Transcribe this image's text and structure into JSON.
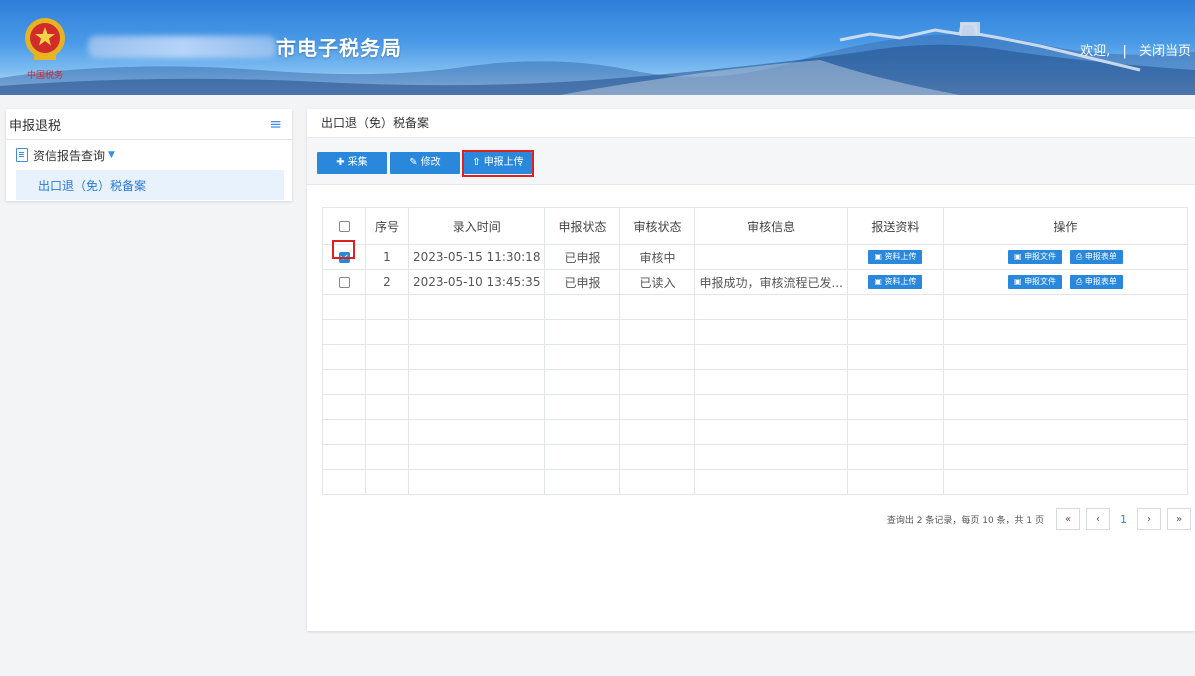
{
  "header": {
    "title": "市电子税务局",
    "welcome": "欢迎,",
    "separator": "|",
    "close_page": "关闭当页"
  },
  "sidebar": {
    "title": "申报退税",
    "group_label": "资信报告查询",
    "items": [
      {
        "label": "出口退（免）税备案",
        "active": true
      }
    ]
  },
  "main": {
    "breadcrumb": "出口退（免）税备案",
    "toolbar": {
      "collect": "采集",
      "modify": "修改",
      "upload": "申报上传"
    },
    "table": {
      "headers": [
        "",
        "序号",
        "录入时间",
        "申报状态",
        "审核状态",
        "审核信息",
        "报送资料",
        "操作"
      ],
      "rows": [
        {
          "checked": true,
          "no": "1",
          "time": "2023-05-15 11:30:18",
          "declare_status": "已申报",
          "review_status": "审核中",
          "review_info": "",
          "upload_label": "资料上传",
          "file_label": "申报文件",
          "form_label": "申报表单"
        },
        {
          "checked": false,
          "no": "2",
          "time": "2023-05-10 13:45:35",
          "declare_status": "已申报",
          "review_status": "已读入",
          "review_info": "申报成功，审核流程已发...",
          "upload_label": "资料上传",
          "file_label": "申报文件",
          "form_label": "申报表单"
        }
      ]
    },
    "pager": {
      "info": "查询出 2 条记录，每页 10 条，共 1 页",
      "first": "«",
      "prev": "‹",
      "page": "1",
      "next": "›",
      "last": "»"
    }
  },
  "colors": {
    "accent": "#2a88dc",
    "highlight": "#e02020"
  }
}
